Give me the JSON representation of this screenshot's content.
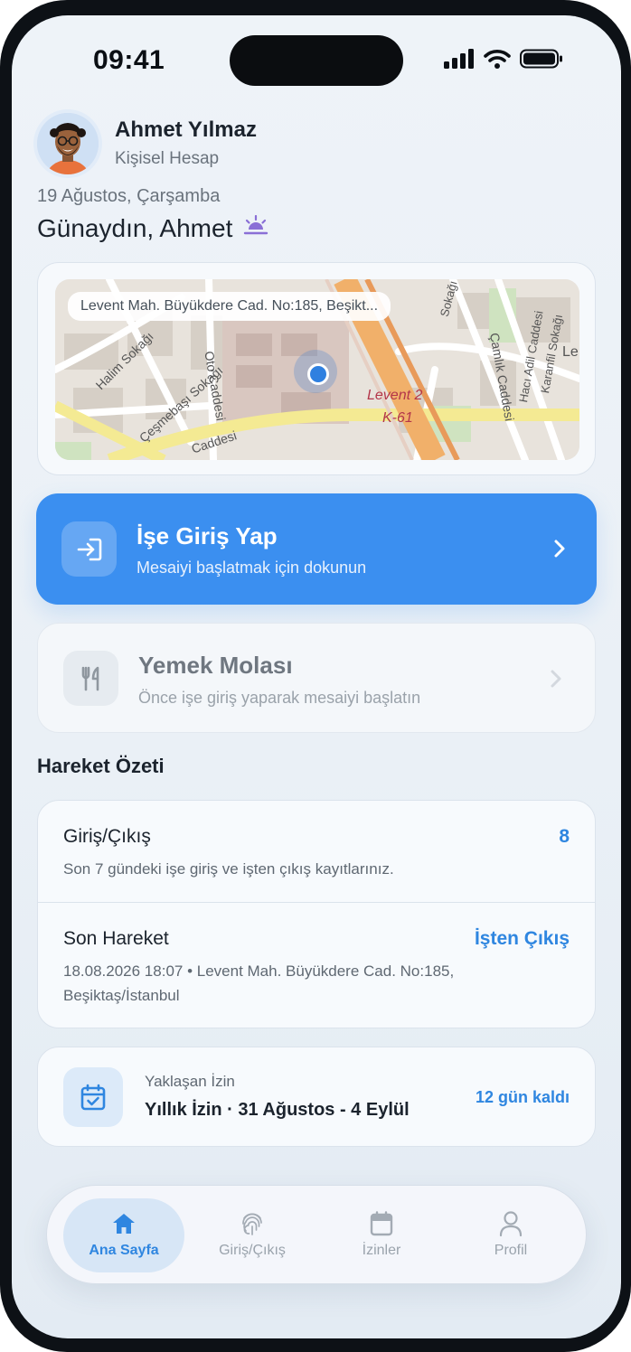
{
  "status_bar": {
    "time": "09:41"
  },
  "profile": {
    "name": "Ahmet Yılmaz",
    "account_type": "Kişisel Hesap"
  },
  "date_line": "19 Ağustos, Çarşamba",
  "greeting": "Günaydın, Ahmet",
  "map": {
    "address": "Levent Mah. Büyükdere Cad. No:185, Beşikt...",
    "labels": {
      "halim": "Halim Sokağı",
      "cesme": "Çeşmebaşı Sokağı",
      "oto": "Oto Caddesi",
      "caddesi": "Caddesi",
      "camlik": "Çamlık Caddesi",
      "haci": "Hacı Adil Caddesi",
      "karanfil": "Karanfil Sokağı",
      "sokagi": "Sokağı",
      "levent": "Levent 2",
      "k61": "K-61",
      "le": "Le"
    }
  },
  "checkin": {
    "title": "İşe Giriş Yap",
    "subtitle": "Mesaiyi başlatmak için dokunun"
  },
  "meal": {
    "title": "Yemek Molası",
    "subtitle": "Önce işe giriş yaparak mesaiyi başlatın"
  },
  "summary": {
    "section_title": "Hareket Özeti",
    "entries": {
      "title": "Giriş/Çıkış",
      "count": "8",
      "description": "Son 7 gündeki işe giriş ve işten çıkış kayıtlarınız."
    },
    "last": {
      "title": "Son Hareket",
      "action": "İşten Çıkış",
      "detail": "18.08.2026 18:07 • Levent Mah. Büyükdere Cad. No:185, Beşiktaş/İstanbul"
    }
  },
  "leave": {
    "label": "Yaklaşan İzin",
    "value": "Yıllık İzin · 31 Ağustos - 4 Eylül",
    "remaining": "12 gün kaldı"
  },
  "tabs": [
    {
      "label": "Ana Sayfa",
      "icon": "home-icon",
      "active": true
    },
    {
      "label": "Giriş/Çıkış",
      "icon": "fingerprint-icon",
      "active": false
    },
    {
      "label": "İzinler",
      "icon": "calendar-icon",
      "active": false
    },
    {
      "label": "Profil",
      "icon": "person-icon",
      "active": false
    }
  ],
  "colors": {
    "accent": "#3b8ff0",
    "accent_text": "#2f86e0",
    "background": "#eef3f8"
  }
}
